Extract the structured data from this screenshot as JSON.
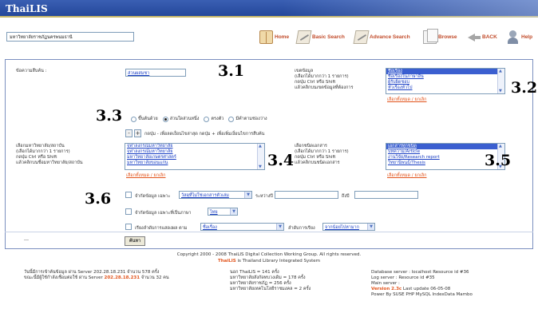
{
  "app": {
    "title": "ThaiLIS"
  },
  "toolbar": {
    "library_select": "มหาวิทยาลัยราชภัฏนครพนมธานี",
    "buttons": [
      {
        "label": "Home",
        "icon": "home-book-icon"
      },
      {
        "label": "Basic Search",
        "icon": "basic-search-pen-icon"
      },
      {
        "label": "Advance Search",
        "icon": "advance-search-pen-icon"
      },
      {
        "label": "Browse",
        "icon": "browse-pages-icon"
      },
      {
        "label": "BACK",
        "icon": "back-arrow-icon"
      },
      {
        "label": "Help",
        "icon": "help-person-icon"
      }
    ]
  },
  "form": {
    "search_label": "ข้อความสืบค้น :",
    "search_value": "ส่วนผสมชา",
    "field_label_lines": [
      "เขตข้อมูล",
      "(เลือกได้มากกว่า 1 รายการ)",
      "กดปุ่ม Ctrl หรือ Shift",
      "แล้วคลิกบนเขตข้อมูลที่ต้องการ"
    ],
    "fields": [
      "ชื่อเรื่อง",
      "ชื่อเรื่องในภาษาอื่น",
      "ผู้รับผิดชอบ",
      "หัวเรื่องทั่วไป"
    ],
    "fields_link": "เลือกทั้งหมด / ยกเลิก",
    "match_options": [
      "ขึ้นต้นด้วย",
      "ส่วนใดส่วนหนึ่ง",
      "ตรงตัว",
      "มีคำตามช่องว่าง"
    ],
    "match_selected": 1,
    "add_hint": "กดปุ่ม - เพื่อลดเงื่อนไขล่าสุด กดปุ่ม + เพื่อเพิ่มเงื่อนไขการสืบค้น",
    "minus": "-",
    "plus": "+",
    "lib_label_lines": [
      "เลือกมหาวิทยาลัย/สถาบัน",
      "(เลือกได้มากกว่า 1 รายการ)",
      "กดปุ่ม Ctrl หรือ Shift",
      "แล้วคลิกบนชื่อมหาวิทยาลัย/สถาบัน"
    ],
    "libraries": [
      "จุฬาลงกรณ์มหาวิทยาลัย",
      "จุฬาลงกรณ์มหาวิทยาลัย",
      "มหาวิทยาลัยเกษตรศาสตร์",
      "มหาวิทยาลัยขอนแก่น"
    ],
    "libraries_link": "เลือกทั้งหมด / ยกเลิก",
    "doctype_label_lines": [
      "เลือกชนิดเอกสาร",
      "(เลือกได้มากกว่า 1 รายการ)",
      "กดปุ่ม Ctrl หรือ Shift",
      "แล้วคลิกบนชนิดเอกสาร"
    ],
    "doctypes": [
      "เอกสารทุกชนิด",
      "บทความ/Article",
      "งานวิจัย/Research report",
      "วิทยานิพนธ์/Thesis"
    ],
    "doctypes_link": "เลือกทั้งหมด / ยกเลิก",
    "limit_format_label": "จำกัดข้อมูล เฉพาะ",
    "format_value": "วัสดุที่ไม่ใช่เอกสารตัวเล่ม",
    "between_label": "ระหว่างปี",
    "to_label": "ถึงปี",
    "limit_lang_label": "จำกัดข้อมูล เฉพาะที่เป็นภาษา",
    "lang_value": "ไทย",
    "sort_label": "เรียงลำดับการแสดงผล ตาม",
    "sort_value": "ชื่อเรื่อง",
    "order_label": "ลำดับการเรียง",
    "order_value": "จากน้อยไปหามาก",
    "dash": "---",
    "submit": "ค้นหา"
  },
  "callouts": [
    "3.1",
    "3.2",
    "3.3",
    "3.4",
    "3.5",
    "3.6"
  ],
  "footer": {
    "copyright": "Copyright 2000 - 2008 ThaiLIS Digital Collection Working Group. All rights reserved.",
    "brand": "ThaiLIS",
    "subtitle": "is Thailand Library Integrated System",
    "left_line1": "วันนี้มีการเข้าค้นข้อมูล ผ่าน Server 202.28.18.231 จำนวน 578 ครั้ง",
    "left_line2_a": "ขณะนี้มีผู้ใช้กำลังเชื่อมต่อใช้ ผ่าน Server",
    "left_line2_ip": "202.28.18.231",
    "left_line2_b": "จำนวน 32 คน",
    "mid": [
      "นอก ThaiLIS = 141 ครั้ง",
      "มหาวิทยาลัยสังกัดทบวงเดิม = 178 ครั้ง",
      "มหาวิทยาลัยราชภัฏ = 256 ครั้ง",
      "มหาวิทยาลัยเทคโนโลยีราชมงคล = 2 ครั้ง"
    ],
    "right1": "Database server : localhost Resource id #36",
    "right2": "Log server : Resource id #35",
    "right3": "Main server :",
    "version": "Version 2.3c",
    "last_update": "Last update 06-05-08",
    "powered": "Power By SUSE PHP MySQL IndexData Mambo"
  }
}
